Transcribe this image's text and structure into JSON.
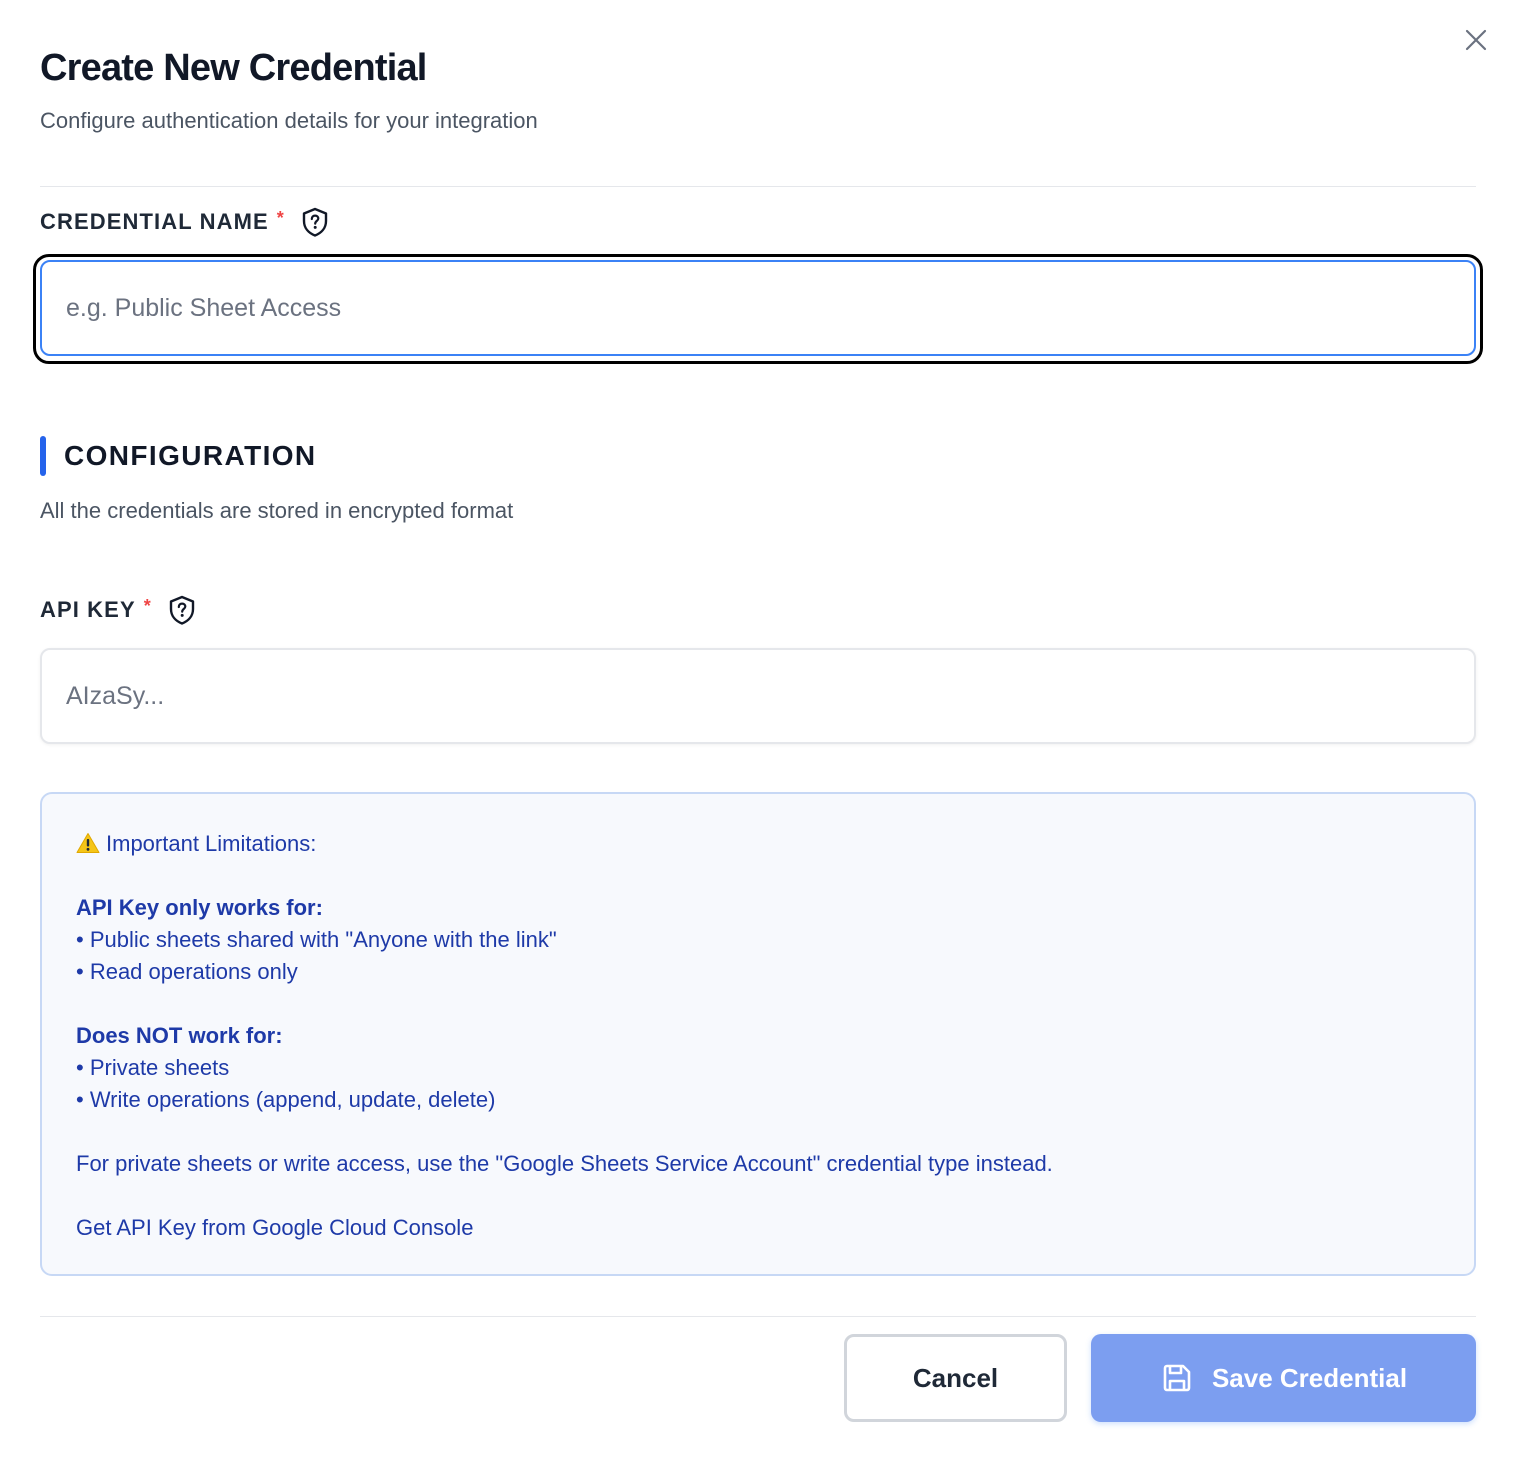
{
  "dialog": {
    "title": "Create New Credential",
    "subtitle": "Configure authentication details for your integration"
  },
  "credential_name": {
    "label": "CREDENTIAL NAME",
    "required_mark": "*",
    "placeholder": "e.g. Public Sheet Access",
    "value": ""
  },
  "configuration": {
    "title": "CONFIGURATION",
    "description": "All the credentials are stored in encrypted format"
  },
  "api_key": {
    "label": "API KEY",
    "required_mark": "*",
    "placeholder": "AIzaSy...",
    "value": ""
  },
  "info": {
    "heading": "Important Limitations:",
    "works_title": "API Key only works for:",
    "works_items": [
      "• Public sheets shared with \"Anyone with the link\"",
      "• Read operations only"
    ],
    "not_title": "Does NOT work for:",
    "not_items": [
      "• Private sheets",
      "• Write operations (append, update, delete)"
    ],
    "note": "For private sheets or write access, use the \"Google Sheets Service Account\" credential type instead.",
    "link": "Get API Key from Google Cloud Console"
  },
  "footer": {
    "cancel_label": "Cancel",
    "save_label": "Save Credential"
  },
  "icons": {
    "close": "close-icon",
    "help": "shield-question-icon",
    "warning": "warning-icon",
    "save": "save-icon"
  },
  "colors": {
    "accent": "#2563eb",
    "required": "#ef4444",
    "info_text": "#1e3aa8",
    "info_bg": "#f7f9fd",
    "save_button": "#7c9ef0"
  }
}
